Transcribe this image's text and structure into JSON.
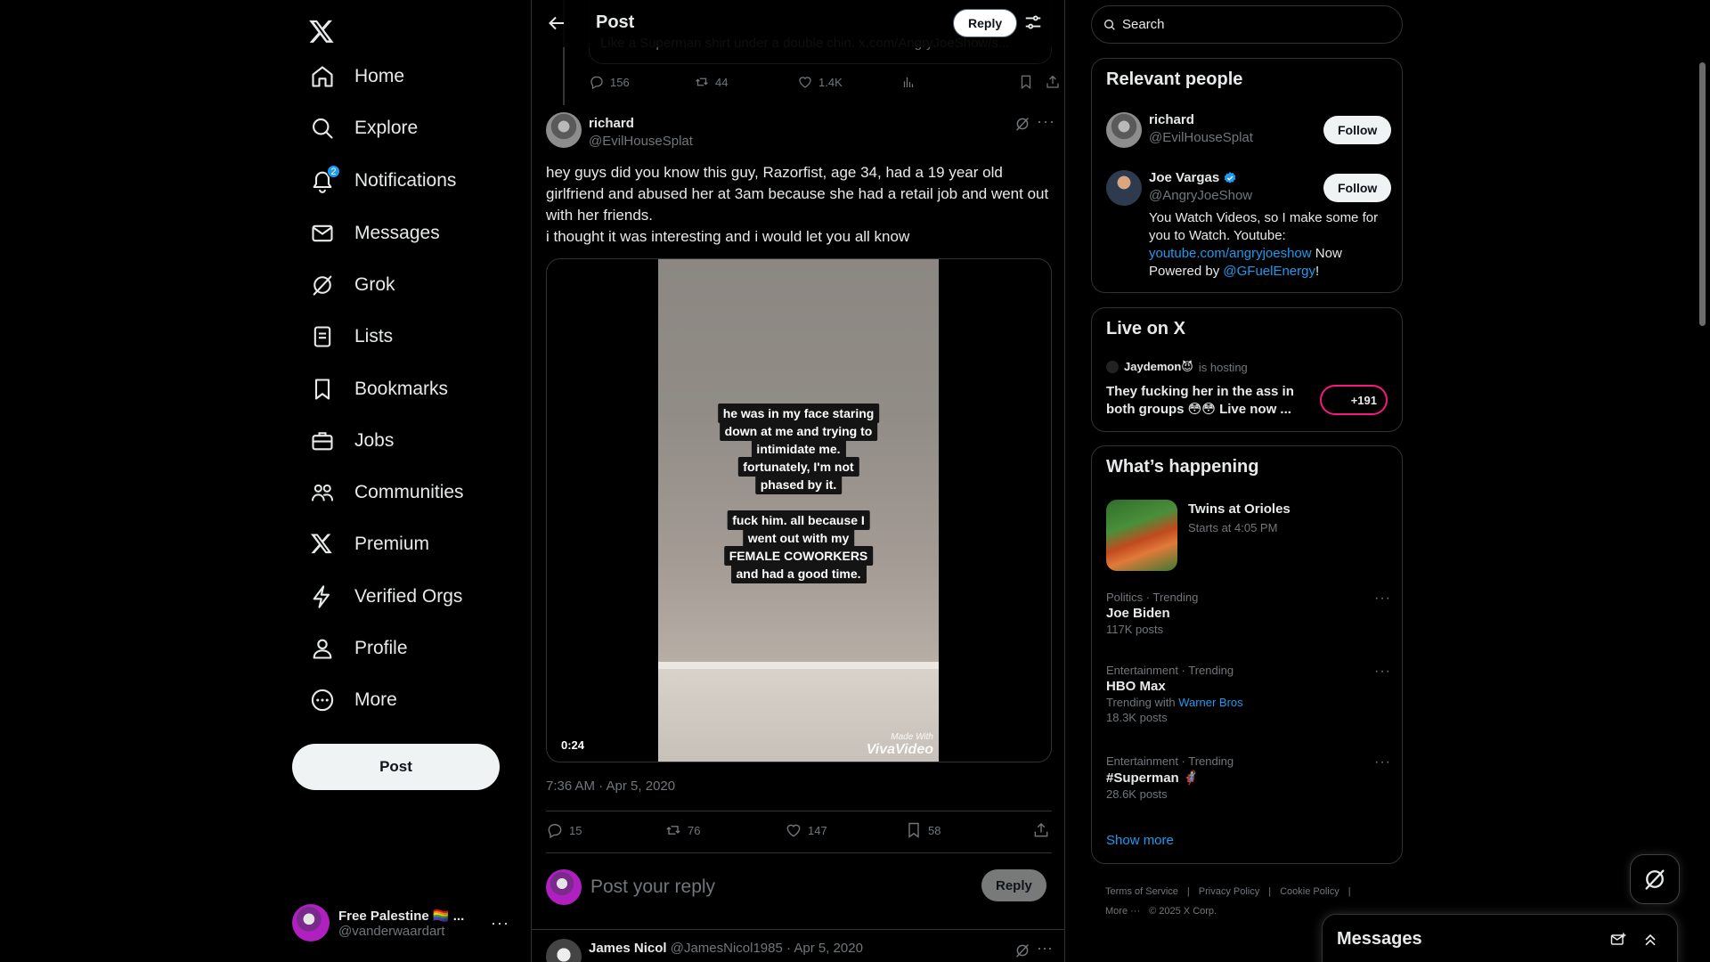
{
  "nav": {
    "items": [
      {
        "label": "Home",
        "icon": "home-icon"
      },
      {
        "label": "Explore",
        "icon": "search-icon"
      },
      {
        "label": "Notifications",
        "icon": "bell-icon",
        "badge": "2"
      },
      {
        "label": "Messages",
        "icon": "mail-icon"
      },
      {
        "label": "Grok",
        "icon": "grok-icon"
      },
      {
        "label": "Lists",
        "icon": "list-icon"
      },
      {
        "label": "Bookmarks",
        "icon": "bookmark-icon"
      },
      {
        "label": "Jobs",
        "icon": "briefcase-icon"
      },
      {
        "label": "Communities",
        "icon": "people-icon"
      },
      {
        "label": "Premium",
        "icon": "x-logo-icon"
      },
      {
        "label": "Verified Orgs",
        "icon": "lightning-icon"
      },
      {
        "label": "Profile",
        "icon": "person-icon"
      },
      {
        "label": "More",
        "icon": "more-circle-icon"
      }
    ],
    "post_label": "Post",
    "account": {
      "name": "Free Palestine 🏳️‍🌈 ...",
      "handle": "@vanderwaardart"
    }
  },
  "header": {
    "title": "Post",
    "reply_label": "Reply"
  },
  "quoted_prev": {
    "text": "Like a Superman shirt under a double chin. x.com/AngryJoeShow/s...",
    "replies": "156",
    "reposts": "44",
    "likes": "1.4K"
  },
  "post": {
    "author_name": "richard",
    "author_handle": "@EvilHouseSplat",
    "text": "hey guys did you know this guy, Razorfist, age 34, had a 19 year old girlfriend and abused her at 3am because she had a retail job and went out with her friends.\ni thought it was interesting and i would let you all know",
    "video": {
      "captions": [
        "he was in my face staring",
        "down at me and trying to",
        "intimidate me.",
        "fortunately, I'm not",
        "phased by it.",
        "fuck him. all because I",
        "went out with my",
        "FEMALE COWORKERS",
        "and had a good time."
      ],
      "duration": "0:24",
      "watermark_top": "Made With",
      "watermark_brand": "VivaVideo"
    },
    "timestamp": "7:36 AM · Apr 5, 2020",
    "replies": "15",
    "reposts": "76",
    "likes": "147",
    "bookmarks": "58"
  },
  "composer": {
    "placeholder": "Post your reply",
    "reply_label": "Reply"
  },
  "next_reply": {
    "name": "James Nicol",
    "handle": "@JamesNicol1985",
    "date": "Apr 5, 2020"
  },
  "search": {
    "placeholder": "Search"
  },
  "relevant": {
    "title": "Relevant people",
    "people": [
      {
        "name": "richard",
        "handle": "@EvilHouseSplat",
        "follow": "Follow"
      },
      {
        "name": "Joe Vargas",
        "handle": "@AngryJoeShow",
        "follow": "Follow",
        "bio_1": "You Watch Videos, so I make some for you to Watch. Youtube: ",
        "bio_link": "youtube.com/angryjoeshow",
        "bio_2": " Now Powered by ",
        "bio_mention": "@GFuelEnergy",
        "bio_3": "!"
      }
    ]
  },
  "live": {
    "title": "Live on X",
    "host": "Jaydemon😈",
    "hosting_text": "is hosting",
    "space_title": "They fucking her in the ass in both groups 😳😳 Live now ...",
    "listeners": "+191"
  },
  "happening": {
    "title": "What’s happening",
    "featured": {
      "title": "Twins at Orioles",
      "subtitle": "Starts at 4:05 PM"
    },
    "trends": [
      {
        "context": "Politics · Trending",
        "name": "Joe Biden",
        "posts": "117K posts"
      },
      {
        "context": "Entertainment · Trending",
        "name": "HBO Max",
        "with_label": "Trending with",
        "with_value": "Warner Bros",
        "posts": "18.3K posts"
      },
      {
        "context": "Entertainment · Trending",
        "name": "#Superman 🦸",
        "posts": "28.6K posts"
      }
    ],
    "show_more": "Show more"
  },
  "footer": {
    "links": [
      "Terms of Service",
      "|",
      "Privacy Policy",
      "|",
      "Cookie Policy",
      "|"
    ],
    "more": "More ···",
    "copyright": "© 2025 X Corp."
  },
  "drawer": {
    "title": "Messages"
  },
  "colors": {
    "accent": "#1d9bf0",
    "live": "#f91880",
    "text": "#e7e9ea",
    "muted": "#71767b",
    "border": "#2f3336"
  }
}
